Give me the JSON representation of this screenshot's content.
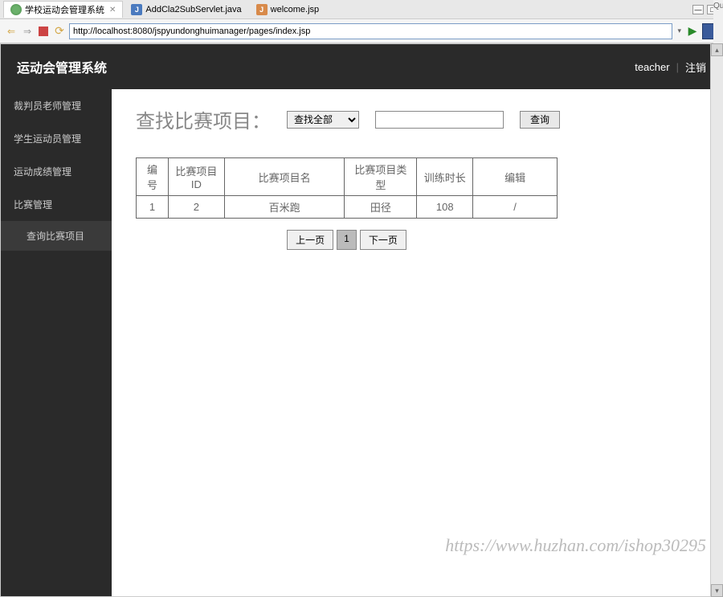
{
  "tabs": [
    {
      "label": "学校运动会管理系统",
      "icon": "globe"
    },
    {
      "label": "AddCla2SubServlet.java",
      "icon": "j"
    },
    {
      "label": "welcome.jsp",
      "icon": "jsp"
    }
  ],
  "url": "http://localhost:8080/jspyundonghuimanager/pages/index.jsp",
  "header": {
    "logo": "运动会管理系统",
    "user": "teacher",
    "logout": "注销"
  },
  "sidebar": {
    "items": [
      {
        "label": "裁判员老师管理"
      },
      {
        "label": "学生运动员管理"
      },
      {
        "label": "运动成绩管理"
      },
      {
        "label": "比赛管理"
      }
    ],
    "subitem": "查询比赛项目"
  },
  "search": {
    "title": "查找比赛项目：",
    "select_option": "查找全部",
    "button": "查询"
  },
  "table": {
    "headers": [
      "编号",
      "比赛项目ID",
      "比赛项目名",
      "比赛项目类型",
      "训练时长",
      "编辑"
    ],
    "rows": [
      {
        "no": "1",
        "id": "2",
        "name": "百米跑",
        "type": "田径",
        "duration": "108",
        "edit": "/"
      }
    ]
  },
  "pagination": {
    "prev": "上一页",
    "current": "1",
    "next": "下一页"
  },
  "watermark": "https://www.huzhan.com/ishop30295",
  "right_edge_text": "Qui"
}
